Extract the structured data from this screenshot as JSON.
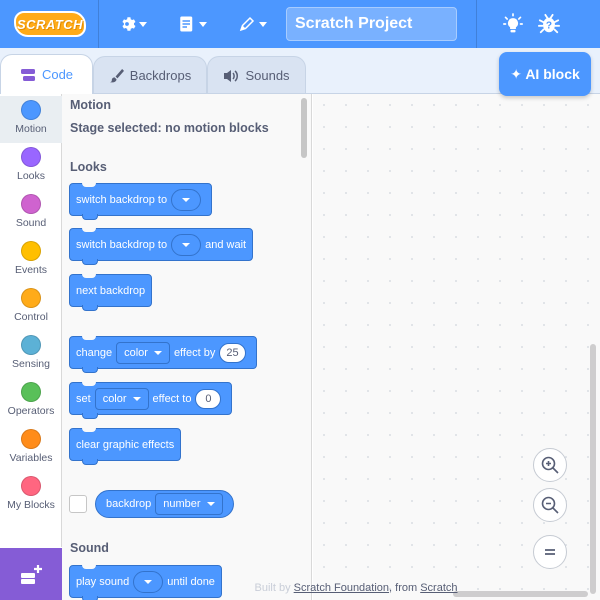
{
  "menubar": {
    "logo_text": "SCRATCH",
    "project_title": "Scratch Project",
    "colors": {
      "bar": "#4c97ff",
      "logo": "#ffab19"
    }
  },
  "tabs": [
    {
      "label": "Code",
      "icon": "code-blocks-icon",
      "active": true
    },
    {
      "label": "Backdrops",
      "icon": "paintbrush-icon",
      "active": false
    },
    {
      "label": "Sounds",
      "icon": "speaker-icon",
      "active": false
    }
  ],
  "ai_button": {
    "label": "✦ AI block"
  },
  "categories": [
    {
      "label": "Motion",
      "color": "#4c97ff",
      "active": true
    },
    {
      "label": "Looks",
      "color": "#9966ff"
    },
    {
      "label": "Sound",
      "color": "#cf63cf"
    },
    {
      "label": "Events",
      "color": "#ffbf00"
    },
    {
      "label": "Control",
      "color": "#ffab19"
    },
    {
      "label": "Sensing",
      "color": "#5cb1d6"
    },
    {
      "label": "Operators",
      "color": "#59c059"
    },
    {
      "label": "Variables",
      "color": "#ff8c1a"
    },
    {
      "label": "My Blocks",
      "color": "#ff6680"
    }
  ],
  "flyout": {
    "motion_heading": "Motion",
    "motion_message": "Stage selected: no motion blocks",
    "looks_heading": "Looks",
    "sound_heading": "Sound",
    "blocks": {
      "switch_backdrop": "switch backdrop to",
      "switch_backdrop_wait_a": "switch backdrop to",
      "switch_backdrop_wait_b": "and wait",
      "next_backdrop": "next backdrop",
      "change_a": "change",
      "change_dd": "color",
      "change_b": "effect by",
      "change_val": "25",
      "set_a": "set",
      "set_dd": "color",
      "set_b": "effect to",
      "set_val": "0",
      "clear_effects": "clear graphic effects",
      "backdrop_reporter": "backdrop",
      "backdrop_dd": "number",
      "play_sound_a": "play sound",
      "play_sound_b": "until done"
    }
  },
  "footer": {
    "text_faded": "Built by",
    "link1": "Scratch Foundation",
    "text_mid": ", from",
    "link2": "Scratch"
  }
}
